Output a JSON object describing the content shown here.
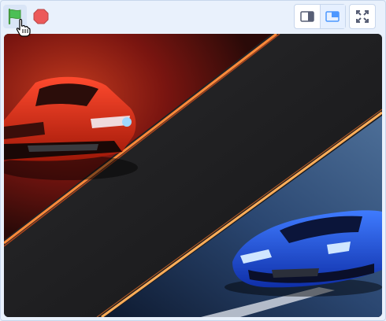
{
  "toolbar": {
    "green_flag": {
      "icon": "green-flag-icon",
      "color": "#4cbf56"
    },
    "stop": {
      "icon": "stop-icon",
      "color": "#ec5959"
    },
    "small_stage": {
      "icon": "small-stage-icon"
    },
    "large_stage": {
      "icon": "large-stage-icon",
      "active": true
    },
    "full_screen": {
      "icon": "full-screen-icon"
    }
  },
  "stage": {
    "backdrop": "red-car-vs-blue-car-racing-backdrop",
    "colors": {
      "red_panel": "#8a1a12",
      "blue_panel": "#1f3a6a",
      "divider_glow": "#ff9a3c",
      "red_car": "#d92a1a",
      "blue_car": "#1c4fe8",
      "asphalt": "#1e1e20"
    }
  },
  "colors": {
    "accent": "#4c97ff",
    "toolbar_bg": "#e9f1fc",
    "border": "#c7d6ec"
  }
}
